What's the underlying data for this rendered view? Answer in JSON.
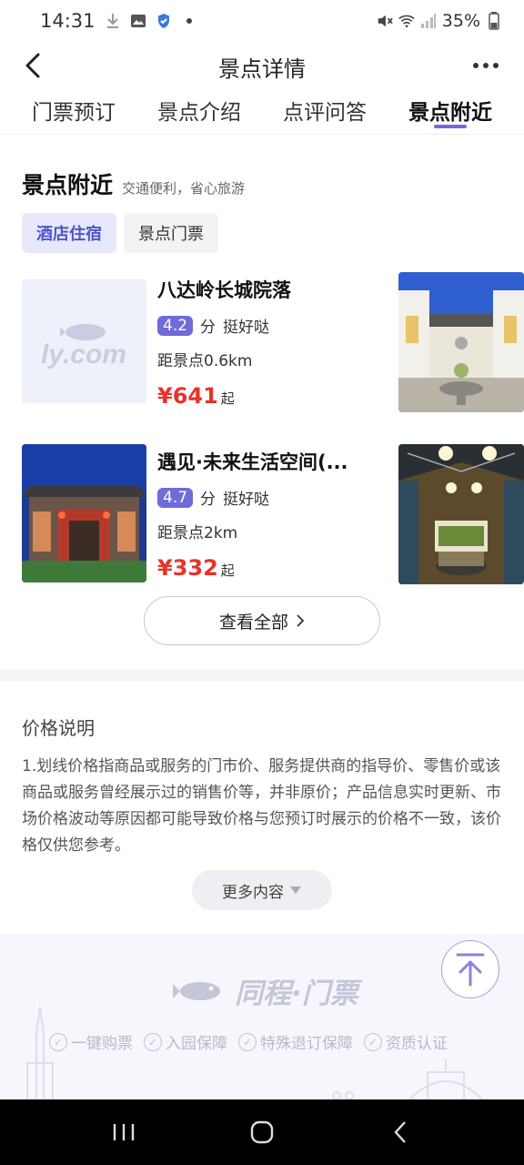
{
  "status": {
    "time": "14:31",
    "battery": "35%"
  },
  "header": {
    "title": "景点详情"
  },
  "tabs": [
    {
      "label": "门票预订",
      "active": false
    },
    {
      "label": "景点介绍",
      "active": false
    },
    {
      "label": "点评问答",
      "active": false
    },
    {
      "label": "景点附近",
      "active": true
    }
  ],
  "nearby": {
    "title": "景点附近",
    "subtitle": "交通便利，省心旅游",
    "chips": [
      {
        "label": "酒店住宿",
        "active": true
      },
      {
        "label": "景点门票",
        "active": false
      }
    ],
    "hotels": [
      {
        "name": "八达岭长城院落",
        "score": "4.2",
        "score_unit": "分",
        "comment": "挺好哒",
        "distance": "距景点0.6km",
        "price": "¥641",
        "price_suffix": "起",
        "placeholder_logo": "ly.com"
      },
      {
        "name": "遇见·未来生活空间(...",
        "score": "4.7",
        "score_unit": "分",
        "comment": "挺好哒",
        "distance": "距景点2km",
        "price": "¥332",
        "price_suffix": "起"
      }
    ],
    "view_all": "查看全部"
  },
  "price_note": {
    "title": "价格说明",
    "text": "1.划线价格指商品或服务的门市价、服务提供商的指导价、零售价或该商品或服务曾经展示过的销售价等，并非原价；产品信息实时更新、市场价格波动等原因都可能导致价格与您预订时展示的价格不一致，该价格仅供您参考。",
    "more": "更多内容"
  },
  "footer": {
    "brand": "同程·门票",
    "guarantees": [
      "一键购票",
      "入园保障",
      "特殊退订保障",
      "资质认证"
    ]
  },
  "colors": {
    "accent": "#6f6bd8",
    "price": "#e8322a",
    "chip_active_bg": "#e7e9fb"
  }
}
